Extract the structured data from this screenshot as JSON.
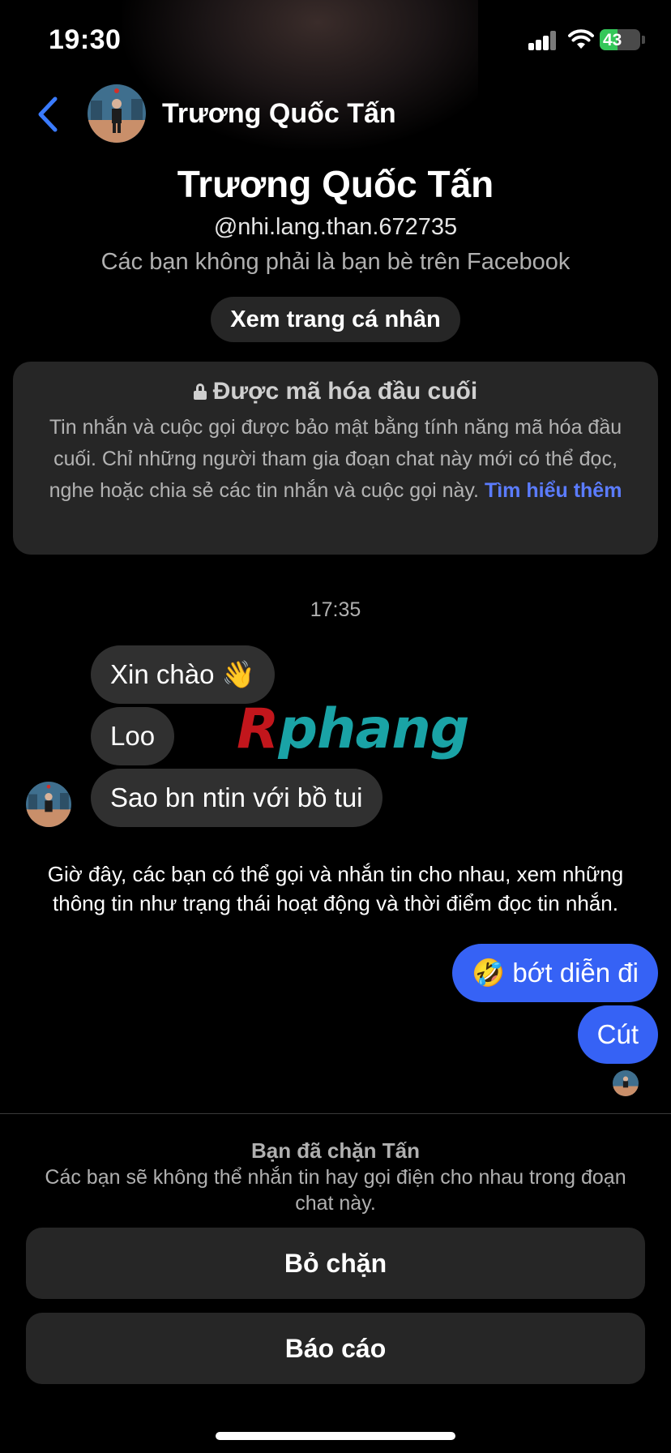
{
  "status_bar": {
    "time": "19:30",
    "battery_text": "43",
    "battery_level_percent": 43
  },
  "header": {
    "name": "Trương Quốc Tấn"
  },
  "profile": {
    "name": "Trương Quốc Tấn",
    "handle": "@nhi.lang.than.672735",
    "note": "Các bạn không phải là bạn bè trên Facebook",
    "view_profile_label": "Xem trang cá nhân"
  },
  "encryption": {
    "title": "Được mã hóa đầu cuối",
    "body": "Tin nhắn và cuộc gọi được bảo mật bằng tính năng mã hóa đầu cuối. Chỉ những người tham gia đoạn chat này mới có thể đọc, nghe hoặc chia sẻ các tin nhắn và cuộc gọi này.",
    "link": "Tìm hiểu thêm"
  },
  "chat": {
    "timestamp": "17:35",
    "incoming": [
      "Xin chào 👋",
      "Loo",
      "Sao bn ntin với bồ tui"
    ],
    "system_notice": "Giờ đây, các bạn có thể gọi và nhắn tin cho nhau, xem những thông tin như trạng thái hoạt động và thời điểm đọc tin nhắn.",
    "outgoing": [
      "🤣 bớt diễn đi",
      "Cút"
    ]
  },
  "watermark": {
    "part1": "R",
    "part2": "phang"
  },
  "block": {
    "title": "Bạn đã chặn Tấn",
    "description": "Các bạn sẽ không thể nhắn tin hay gọi điện cho nhau trong đoạn chat này.",
    "unblock_label": "Bỏ chặn",
    "report_label": "Báo cáo"
  },
  "colors": {
    "accent": "#3662f5",
    "link": "#5b7cff",
    "bubble_in": "#303030",
    "battery": "#34c759"
  }
}
